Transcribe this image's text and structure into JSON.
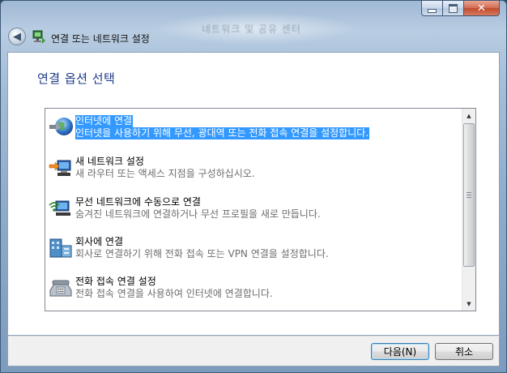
{
  "window": {
    "title": "연결 또는 네트워크 설정",
    "ghost_title": "네트워크 및 공유 센터"
  },
  "page": {
    "heading": "연결 옵션 선택"
  },
  "options": [
    {
      "title": "인터넷에 연결",
      "description": "인터넷을 사용하기 위해 무선, 광대역 또는 전화 접속 연결을 설정합니다.",
      "icon": "globe-icon",
      "selected": true
    },
    {
      "title": "새 네트워크 설정",
      "description": "새 라우터 또는 액세스 지점을 구성하십시오.",
      "icon": "network-setup-icon",
      "selected": false
    },
    {
      "title": "무선 네트워크에 수동으로 연결",
      "description": "숨겨진 네트워크에 연결하거나 무선 프로필을 새로 만듭니다.",
      "icon": "wireless-network-icon",
      "selected": false
    },
    {
      "title": "회사에 연결",
      "description": "회사로 연결하기 위해 전화 접속 또는 VPN 연결을 설정합니다.",
      "icon": "workplace-icon",
      "selected": false
    },
    {
      "title": "전화 접속 연결 설정",
      "description": "전화 접속 연결을 사용하여 인터넷에 연결합니다.",
      "icon": "telephone-icon",
      "selected": false
    }
  ],
  "buttons": {
    "next": "다음(N)",
    "cancel": "취소"
  },
  "colors": {
    "selection": "#3399ff",
    "heading": "#1e3a8a"
  }
}
